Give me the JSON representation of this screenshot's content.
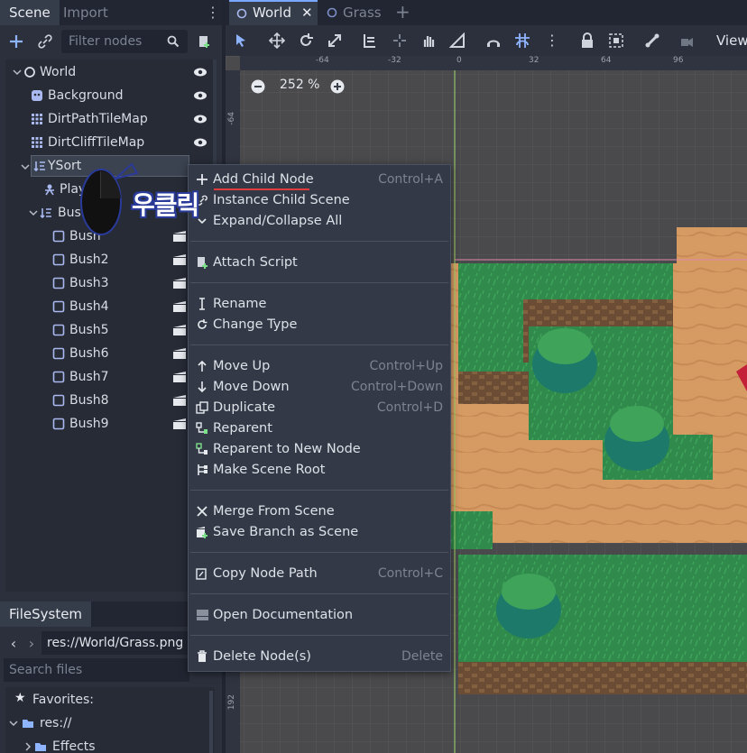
{
  "scene_dock": {
    "tabs": [
      {
        "label": "Scene"
      },
      {
        "label": "Import"
      }
    ],
    "filter_placeholder": "Filter nodes"
  },
  "tree": {
    "nodes": [
      {
        "label": "World",
        "icon": "node-circle-icon"
      },
      {
        "label": "Background",
        "icon": "sprite-icon"
      },
      {
        "label": "DirtPathTileMap",
        "icon": "tilemap-icon"
      },
      {
        "label": "DirtCliffTileMap",
        "icon": "tilemap-icon"
      },
      {
        "label": "YSort",
        "icon": "ysort-icon"
      },
      {
        "label": "Playe",
        "icon": "player-icon"
      },
      {
        "label": "Bush",
        "icon": "ysort-icon"
      },
      {
        "label": "Bush",
        "icon": "node2d-icon"
      },
      {
        "label": "Bush2",
        "icon": "node2d-icon"
      },
      {
        "label": "Bush3",
        "icon": "node2d-icon"
      },
      {
        "label": "Bush4",
        "icon": "node2d-icon"
      },
      {
        "label": "Bush5",
        "icon": "node2d-icon"
      },
      {
        "label": "Bush6",
        "icon": "node2d-icon"
      },
      {
        "label": "Bush7",
        "icon": "node2d-icon"
      },
      {
        "label": "Bush8",
        "icon": "node2d-icon"
      },
      {
        "label": "Bush9",
        "icon": "node2d-icon"
      }
    ]
  },
  "filesystem": {
    "tab_label": "FileSystem",
    "path": "res://World/Grass.png",
    "search_placeholder": "Search files",
    "favorites_label": "Favorites:",
    "root_label": "res://",
    "folder_label": "Effects"
  },
  "editor_tabs": [
    {
      "label": "World"
    },
    {
      "label": "Grass"
    }
  ],
  "viewport": {
    "view_menu": "View",
    "zoom": "252 %",
    "ruler_top": [
      "-64",
      "-32",
      "0",
      "32",
      "64",
      "96"
    ],
    "ruler_left": [
      "-64",
      "192"
    ]
  },
  "context_menu": {
    "items": [
      {
        "label": "Add Child Node",
        "shortcut": "Control+A",
        "icon": "plus-icon"
      },
      {
        "label": "Instance Child Scene",
        "shortcut": "",
        "icon": "link-icon"
      },
      {
        "label": "Expand/Collapse All",
        "shortcut": "",
        "icon": "chevron-down-icon"
      },
      {
        "label": "Attach Script",
        "shortcut": "",
        "icon": "attach-script-icon"
      },
      {
        "label": "Rename",
        "shortcut": "",
        "icon": "rename-icon"
      },
      {
        "label": "Change Type",
        "shortcut": "",
        "icon": "reload-icon"
      },
      {
        "label": "Move Up",
        "shortcut": "Control+Up",
        "icon": "arrow-up-icon"
      },
      {
        "label": "Move Down",
        "shortcut": "Control+Down",
        "icon": "arrow-down-icon"
      },
      {
        "label": "Duplicate",
        "shortcut": "Control+D",
        "icon": "duplicate-icon"
      },
      {
        "label": "Reparent",
        "shortcut": "",
        "icon": "reparent-icon"
      },
      {
        "label": "Reparent to New Node",
        "shortcut": "",
        "icon": "reparent-new-icon"
      },
      {
        "label": "Make Scene Root",
        "shortcut": "",
        "icon": "scene-root-icon"
      },
      {
        "label": "Merge From Scene",
        "shortcut": "",
        "icon": "merge-icon"
      },
      {
        "label": "Save Branch as Scene",
        "shortcut": "",
        "icon": "save-branch-icon"
      },
      {
        "label": "Copy Node Path",
        "shortcut": "Control+C",
        "icon": "copy-path-icon"
      },
      {
        "label": "Open Documentation",
        "shortcut": "",
        "icon": "doc-icon"
      },
      {
        "label": "Delete Node(s)",
        "shortcut": "Delete",
        "icon": "trash-icon"
      }
    ]
  },
  "annotation": {
    "text": "우클릭"
  },
  "colors": {
    "accent": "#7aa7ff",
    "underline": "#e23b3b",
    "grass": "#2f8a4b",
    "dirt": "#d69a63"
  }
}
